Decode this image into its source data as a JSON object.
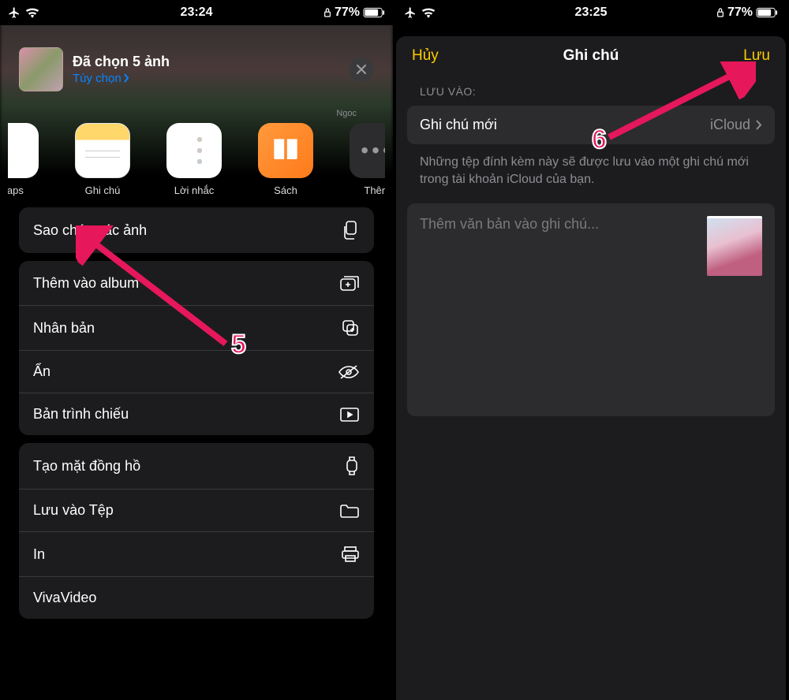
{
  "left": {
    "status": {
      "time": "23:24",
      "battery": "77%"
    },
    "sheet": {
      "title": "Đã chọn 5 ảnh",
      "options_link": "Tùy chọn",
      "contact_name": "Ngoc"
    },
    "apps": {
      "maps": "Maps",
      "notes": "Ghi chú",
      "reminders": "Lời nhắc",
      "books": "Sách",
      "more": "Thêm"
    },
    "actions": {
      "copy": "Sao chép các ảnh",
      "add_album": "Thêm vào album",
      "duplicate": "Nhân bản",
      "hide": "Ẩn",
      "slideshow": "Bản trình chiếu",
      "watchface": "Tạo mặt đồng hồ",
      "save_files": "Lưu vào Tệp",
      "print": "In",
      "viva": "VivaVideo"
    },
    "callout": "5"
  },
  "right": {
    "status": {
      "time": "23:25",
      "battery": "77%"
    },
    "header": {
      "cancel": "Hủy",
      "title": "Ghi chú",
      "save": "Lưu"
    },
    "section_label": "LƯU VÀO:",
    "dest": {
      "name": "Ghi chú mới",
      "account": "iCloud"
    },
    "help": "Những tệp đính kèm này sẽ được lưu vào một ghi chú mới trong tài khoản iCloud của bạn.",
    "placeholder": "Thêm văn bản vào ghi chú...",
    "callout": "6"
  }
}
